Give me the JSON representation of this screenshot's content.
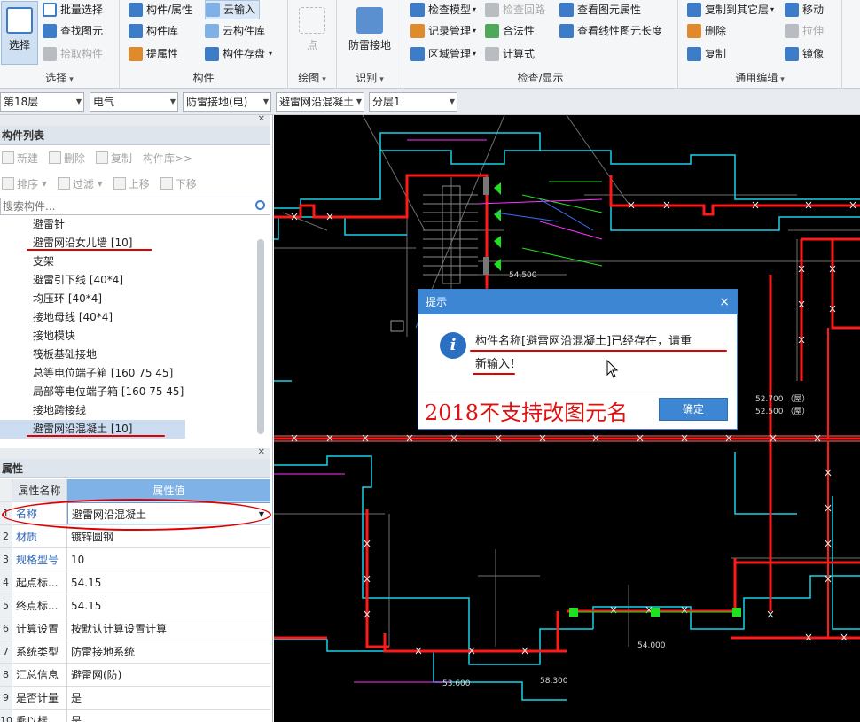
{
  "ribbon": {
    "select": {
      "big_label": "选择",
      "items": [
        "批量选择",
        "查找图元",
        "拾取构件"
      ],
      "group": "选择"
    },
    "component": {
      "items_col1": [
        "构件/属性",
        "构件库",
        "提属性"
      ],
      "items_col2": [
        "云输入",
        "云构件库",
        "构件存盘"
      ],
      "group": "构件"
    },
    "draw": {
      "big_label": "点",
      "group": "绘图"
    },
    "identify": {
      "big_label": "防雷接地",
      "group": "识别"
    },
    "check": {
      "items_col1": [
        "检查模型",
        "记录管理",
        "区域管理"
      ],
      "items_col2": [
        "检查回路",
        "合法性",
        "计算式"
      ],
      "items_col3": [
        "查看图元属性",
        "查看线性图元长度"
      ],
      "group": "检查/显示"
    },
    "edit": {
      "items_col1": [
        "复制到其它层",
        "删除",
        "复制"
      ],
      "items_col2": [
        "移动",
        "拉伸",
        "镜像"
      ],
      "group": "通用编辑"
    }
  },
  "filterbar": {
    "floor": "第18层",
    "discipline": "电气",
    "type": "防雷接地(电)",
    "component": "避雷网沿混凝土",
    "layer": "分层1"
  },
  "component_list": {
    "title": "构件列表",
    "toolbar_row1": [
      "新建",
      "删除",
      "复制",
      "构件库>>"
    ],
    "toolbar_row2": [
      "排序",
      "过滤",
      "上移",
      "下移"
    ],
    "search_placeholder": "搜索构件...",
    "items": [
      "避雷针",
      "避雷网沿女儿墙 [10]",
      "支架",
      "避雷引下线 [40*4]",
      "均压环 [40*4]",
      "接地母线 [40*4]",
      "接地模块",
      "筏板基础接地",
      "总等电位端子箱 [160 75 45]",
      "局部等电位端子箱 [160 75 45]",
      "接地跨接线",
      "避雷网沿混凝土 [10]"
    ]
  },
  "properties": {
    "title": "属性",
    "col_name": "属性名称",
    "col_value": "属性值",
    "rows": [
      {
        "num": "1",
        "name": "名称",
        "value": "避雷网沿混凝土"
      },
      {
        "num": "2",
        "name": "材质",
        "value": "镀锌圆钢"
      },
      {
        "num": "3",
        "name": "规格型号",
        "value": "10"
      },
      {
        "num": "4",
        "name": "起点标...",
        "value": "54.15"
      },
      {
        "num": "5",
        "name": "终点标...",
        "value": "54.15"
      },
      {
        "num": "6",
        "name": "计算设置",
        "value": "按默认计算设置计算"
      },
      {
        "num": "7",
        "name": "系统类型",
        "value": "防雷接地系统"
      },
      {
        "num": "8",
        "name": "汇总信息",
        "value": "避雷网(防)"
      },
      {
        "num": "9",
        "name": "是否计量",
        "value": "是"
      },
      {
        "num": "10",
        "name": "乘以标...",
        "value": "是"
      }
    ]
  },
  "canvas": {
    "labels": [
      "52.700 （屋）",
      "52.500 （屋）",
      "54.500",
      "54.000",
      "53.600",
      "58.300"
    ]
  },
  "dialog": {
    "title": "提示",
    "message_line1": "构件名称[避雷网沿混凝土]已经存在，请重",
    "message_line2": "新输入！",
    "ok_label": "确定",
    "close_glyph": "×"
  },
  "annotation": {
    "text": "2018不支持改图元名"
  },
  "colors": {
    "annotation_red": "#e01010",
    "dialog_blue": "#3d86d4",
    "cad_background": "#000000"
  }
}
